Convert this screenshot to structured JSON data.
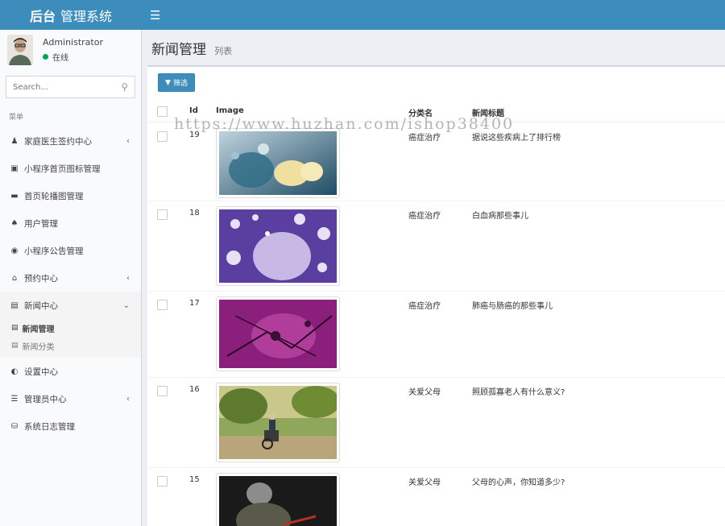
{
  "brand": {
    "bold": "后台",
    "rest": "管理系统"
  },
  "toggle_icon": "hamburger-icon",
  "user": {
    "name": "Administrator",
    "status": "在线"
  },
  "search": {
    "placeholder": "Search..."
  },
  "menu": {
    "header": "菜单",
    "items": [
      {
        "label": "家庭医生签约中心",
        "icon": "user-plus-icon",
        "chevron": "‹"
      },
      {
        "label": "小程序首页图标管理",
        "icon": "archive-icon"
      },
      {
        "label": "首页轮播图管理",
        "icon": "credit-card-icon"
      },
      {
        "label": "用户管理",
        "icon": "users-icon"
      },
      {
        "label": "小程序公告管理",
        "icon": "dot-circle-icon"
      },
      {
        "label": "预约中心",
        "icon": "bank-icon",
        "chevron": "‹"
      },
      {
        "label": "新闻中心",
        "icon": "bar-chart-icon",
        "chevron": "⌄"
      },
      {
        "label": "设置中心",
        "icon": "toggle-icon"
      },
      {
        "label": "管理员中心",
        "icon": "list-icon",
        "chevron": "‹"
      },
      {
        "label": "系统日志管理",
        "icon": "database-icon"
      }
    ],
    "sub_items": [
      {
        "label": "新闻管理"
      },
      {
        "label": "新闻分类"
      }
    ]
  },
  "page": {
    "title": "新闻管理",
    "subtitle": "列表"
  },
  "toolbar": {
    "filter_label": "筛选"
  },
  "table": {
    "columns": [
      "Id",
      "Image",
      "分类名",
      "新闻标题"
    ],
    "rows": [
      {
        "id": "19",
        "category": "癌症治疗",
        "title": "据说这些疾病上了排行榜"
      },
      {
        "id": "18",
        "category": "癌症治疗",
        "title": "白血病那些事儿"
      },
      {
        "id": "17",
        "category": "癌症治疗",
        "title": "肺癌与肠癌的那些事儿"
      },
      {
        "id": "16",
        "category": "关爱父母",
        "title": "照顾孤寡老人有什么意义?"
      },
      {
        "id": "15",
        "category": "关爱父母",
        "title": "父母的心声，你知道多少?"
      }
    ]
  },
  "watermark": "https://www.huzhan.com/ishop38400"
}
